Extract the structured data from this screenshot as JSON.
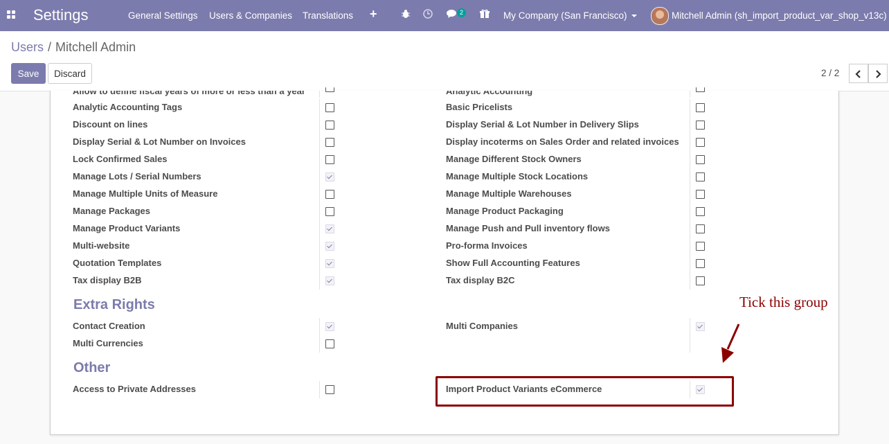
{
  "navbar": {
    "brand": "Settings",
    "menus": [
      "General Settings",
      "Users & Companies",
      "Translations"
    ],
    "plus_icon": "+",
    "messages_count": "2",
    "company": "My Company (San Francisco)",
    "user": "Mitchell Admin (sh_import_product_var_shop_v13c)"
  },
  "breadcrumb": {
    "parent": "Users",
    "separator": "/",
    "current": "Mitchell Admin"
  },
  "buttons": {
    "save": "Save",
    "discard": "Discard"
  },
  "pager": {
    "value": "2 / 2"
  },
  "top_partial": {
    "left": "Allow to define fiscal years of more or less than a year",
    "right": "Analytic Accounting"
  },
  "technical_rows": [
    {
      "left": "Analytic Accounting Tags",
      "left_checked": false,
      "right": "Basic Pricelists",
      "right_checked": false
    },
    {
      "left": "Discount on lines",
      "left_checked": false,
      "right": "Display Serial & Lot Number in Delivery Slips",
      "right_checked": false
    },
    {
      "left": "Display Serial & Lot Number on Invoices",
      "left_checked": false,
      "right": "Display incoterms on Sales Order and related invoices",
      "right_checked": false
    },
    {
      "left": "Lock Confirmed Sales",
      "left_checked": false,
      "right": "Manage Different Stock Owners",
      "right_checked": false
    },
    {
      "left": "Manage Lots / Serial Numbers",
      "left_checked": true,
      "right": "Manage Multiple Stock Locations",
      "right_checked": false
    },
    {
      "left": "Manage Multiple Units of Measure",
      "left_checked": false,
      "right": "Manage Multiple Warehouses",
      "right_checked": false
    },
    {
      "left": "Manage Packages",
      "left_checked": false,
      "right": "Manage Product Packaging",
      "right_checked": false
    },
    {
      "left": "Manage Product Variants",
      "left_checked": true,
      "right": "Manage Push and Pull inventory flows",
      "right_checked": false
    },
    {
      "left": "Multi-website",
      "left_checked": true,
      "right": "Pro-forma Invoices",
      "right_checked": false
    },
    {
      "left": "Quotation Templates",
      "left_checked": true,
      "right": "Show Full Accounting Features",
      "right_checked": false
    },
    {
      "left": "Tax display B2B",
      "left_checked": true,
      "right": "Tax display B2C",
      "right_checked": false
    }
  ],
  "extra_rights": {
    "title": "Extra Rights",
    "rows": [
      {
        "left": "Contact Creation",
        "left_checked": true,
        "right": "Multi Companies",
        "right_checked": true
      },
      {
        "left": "Multi Currencies",
        "left_checked": false
      }
    ]
  },
  "other": {
    "title": "Other",
    "rows": [
      {
        "left": "Access to Private Addresses",
        "left_checked": false,
        "right": "Import Product Variants eCommerce",
        "right_checked": true
      }
    ]
  },
  "annotation": {
    "text": "Tick this group",
    "color": "#8b0000"
  },
  "colors": {
    "primary": "#7c7bad",
    "badge": "#00a09d"
  },
  "icons": [
    "apps-icon",
    "plus-icon",
    "bug-icon",
    "clock-icon",
    "chat-icon",
    "gift-icon",
    "chevron-left-icon",
    "chevron-right-icon"
  ]
}
